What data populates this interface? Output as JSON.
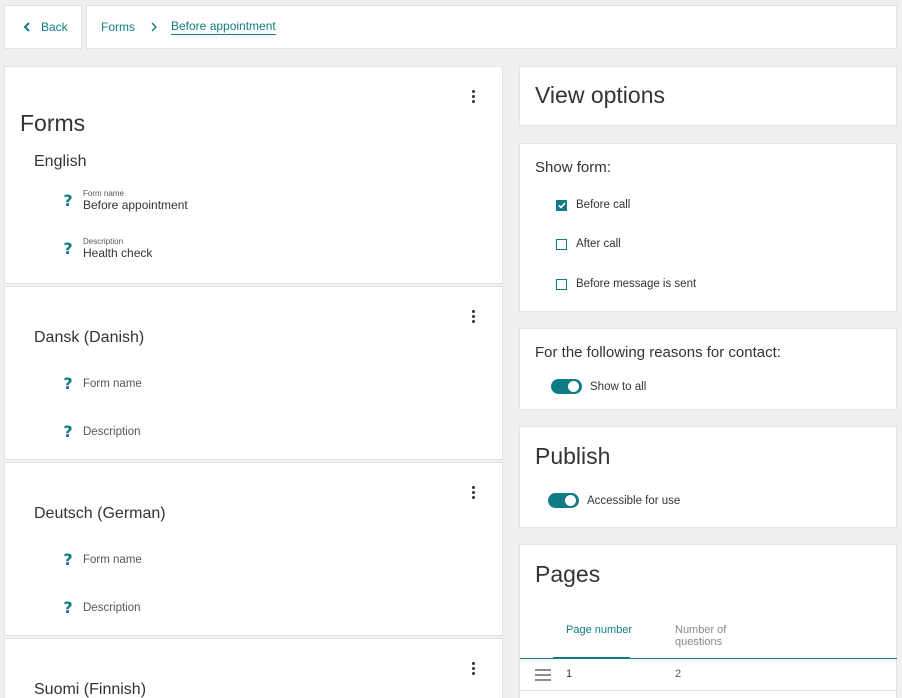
{
  "nav": {
    "back_label": "Back"
  },
  "breadcrumb": {
    "root": "Forms",
    "current": "Before appointment"
  },
  "forms": {
    "title": "Forms",
    "languages": [
      {
        "name": "English",
        "form_name_label": "Form name",
        "form_name_value": "Before appointment",
        "description_label": "Description",
        "description_value": "Health check"
      },
      {
        "name": "Dansk (Danish)",
        "form_name_label": "Form name",
        "description_label": "Description"
      },
      {
        "name": "Deutsch (German)",
        "form_name_label": "Form name",
        "description_label": "Description"
      },
      {
        "name": "Suomi (Finnish)"
      }
    ]
  },
  "view_options": {
    "title": "View options",
    "show_form": {
      "label": "Show form:",
      "options": [
        {
          "label": "Before call",
          "checked": true
        },
        {
          "label": "After call",
          "checked": false
        },
        {
          "label": "Before message is sent",
          "checked": false
        }
      ]
    },
    "reasons": {
      "label": "For the following reasons for contact:",
      "toggle_label": "Show to all",
      "toggle_on": true
    }
  },
  "publish": {
    "title": "Publish",
    "toggle_label": "Accessible for use",
    "toggle_on": true
  },
  "pages": {
    "title": "Pages",
    "columns": [
      "Page number",
      "Number of questions"
    ],
    "rows": [
      {
        "page_number": "1",
        "questions": "2"
      }
    ]
  },
  "colors": {
    "accent": "#0f7b86",
    "background": "#efefef"
  },
  "icons": {
    "back": "chevron-left-icon",
    "separator": "chevron-right-icon",
    "menu": "kebab-menu-icon",
    "help": "question-icon",
    "drag": "drag-handle-icon",
    "check": "checkmark-icon"
  }
}
